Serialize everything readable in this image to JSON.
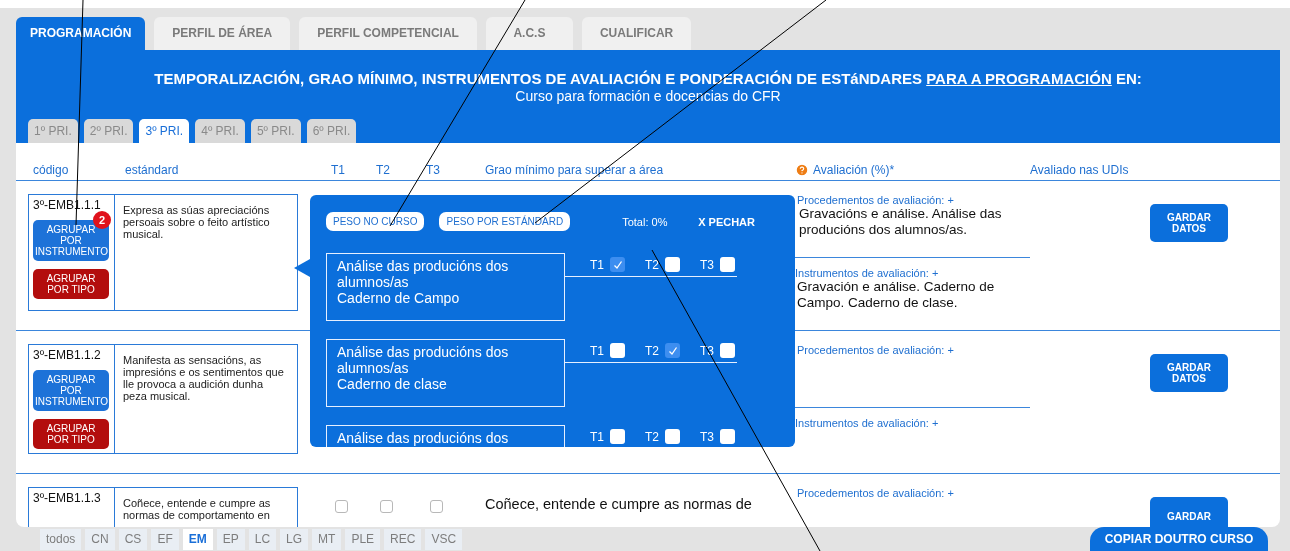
{
  "main_tabs": [
    {
      "label": "PROGRAMACIÓN",
      "selected": true
    },
    {
      "label": "PERFIL DE ÁREA",
      "selected": false
    },
    {
      "label": "PERFIL COMPETENCIAL",
      "selected": false
    },
    {
      "label": "A.C.S",
      "selected": false
    },
    {
      "label": "CUALIFICAR",
      "selected": false
    }
  ],
  "header": {
    "title_before": "TEMPORALIZACIÓN, GRAO MÍNIMO, INSTRUMENTOS DE AVALIACIÓN E PONDERACIÓN DE ESTáNDARES",
    "title_link": "PARA A PROGRAMACIÓN",
    "title_after": "EN:",
    "subtitle": "Curso para formación e docencias do CFR"
  },
  "level_tabs": [
    {
      "label": "1º PRI.",
      "selected": false
    },
    {
      "label": "2º PRI.",
      "selected": false
    },
    {
      "label": "3º PRI.",
      "selected": true
    },
    {
      "label": "4º PRI.",
      "selected": false
    },
    {
      "label": "5º PRI.",
      "selected": false
    },
    {
      "label": "6º PRI.",
      "selected": false
    }
  ],
  "columns": {
    "code": "código",
    "standard": "estándard",
    "t1": "T1",
    "t2": "T2",
    "t3": "T3",
    "minimum": "Grao mínimo para superar a área",
    "evaluation": "Avaliación (%)*",
    "udis": "Avaliado nas UDIs"
  },
  "rows": [
    {
      "code": "3º-EMB1.1.1",
      "standard": "Expresa as súas apreciacións persoais sobre o feito artístico musical.",
      "group_buttons": [
        {
          "kind": "instrument",
          "label": "AGRUPAR POR INSTRUMENTO",
          "badge": "2"
        },
        {
          "kind": "type",
          "label": "AGRUPAR POR TIPO"
        }
      ],
      "procedures": {
        "label": "Procedementos de avaliación: +",
        "value": "Gravacións e análise. Análise das producións dos alumnos/as."
      },
      "instruments": {
        "label": "Instrumentos de avaliación: +",
        "value": "Gravación e análise. Caderno de Campo. Caderno de clase."
      },
      "save_button": "GARDAR DATOS"
    },
    {
      "code": "3º-EMB1.1.2",
      "standard": "Manifesta as sensacións, as impresións e os sentimentos que lle provoca a audición dunha peza musical.",
      "group_buttons": [
        {
          "kind": "instrument",
          "label": "AGRUPAR POR INSTRUMENTO"
        },
        {
          "kind": "type",
          "label": "AGRUPAR POR TIPO"
        }
      ],
      "procedures": {
        "label": "Procedementos de avaliación: +"
      },
      "instruments": {
        "label": "Instrumentos de avaliación: +"
      },
      "save_button": "GARDAR DATOS"
    },
    {
      "code": "3º-EMB1.1.3",
      "standard": "Coñece, entende e cumpre as normas de comportamento en",
      "terms": [
        {
          "checked": false
        },
        {
          "checked": false
        },
        {
          "checked": false
        }
      ],
      "minimum": "Coñece, entende e cumpre as normas de",
      "procedures": {
        "label": "Procedementos de avaliación: +"
      },
      "save_button": "GARDAR"
    }
  ],
  "popup": {
    "buttons": [
      "PESO NO CURSO",
      "PESO POR ESTÁNDARD"
    ],
    "total": "Total: 0%",
    "close": "X PECHAR",
    "items": [
      {
        "lines": [
          "Análise das producións dos alumnos/as",
          "Caderno de Campo"
        ],
        "terms": [
          {
            "label": "T1",
            "checked": true
          },
          {
            "label": "T2",
            "checked": false
          },
          {
            "label": "T3",
            "checked": false
          }
        ]
      },
      {
        "lines": [
          "Análise das producións dos alumnos/as",
          "Caderno de clase"
        ],
        "terms": [
          {
            "label": "T1",
            "checked": false
          },
          {
            "label": "T2",
            "checked": true
          },
          {
            "label": "T3",
            "checked": false
          }
        ]
      },
      {
        "lines": [
          "Análise das producións dos"
        ],
        "terms": [
          {
            "label": "T1",
            "checked": false
          },
          {
            "label": "T2",
            "checked": false
          },
          {
            "label": "T3",
            "checked": false
          }
        ]
      }
    ]
  },
  "filter_tabs": [
    {
      "label": "todos",
      "selected": false
    },
    {
      "label": "CN",
      "selected": false
    },
    {
      "label": "CS",
      "selected": false
    },
    {
      "label": "EF",
      "selected": false
    },
    {
      "label": "EM",
      "selected": true
    },
    {
      "label": "EP",
      "selected": false
    },
    {
      "label": "LC",
      "selected": false
    },
    {
      "label": "LG",
      "selected": false
    },
    {
      "label": "MT",
      "selected": false
    },
    {
      "label": "PLE",
      "selected": false
    },
    {
      "label": "REC",
      "selected": false
    },
    {
      "label": "VSC",
      "selected": false
    }
  ],
  "copy_button": "COPIAR DOUTRO CURSO"
}
